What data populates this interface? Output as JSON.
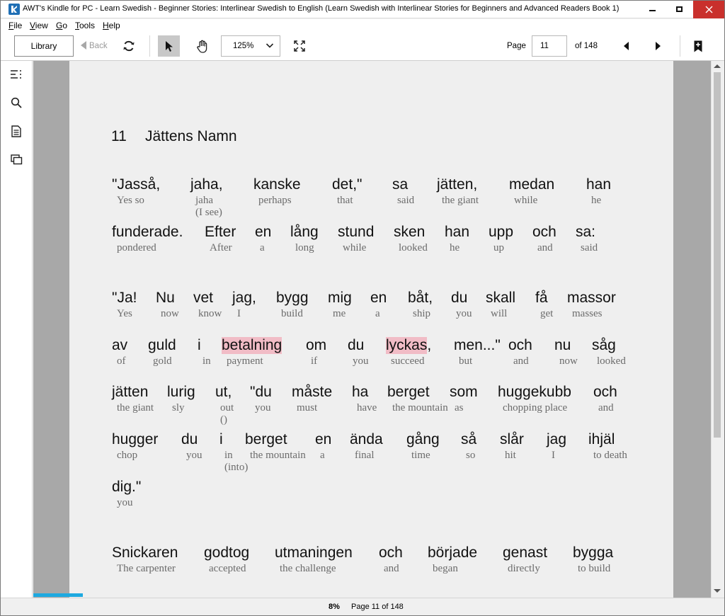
{
  "window": {
    "title": "AWT's Kindle for PC - Learn Swedish - Beginner Stories: Interlinear Swedish to English (Learn Swedish with Interlinear Stories for Beginners and Advanced Readers Book 1)",
    "close_color": "#c9302c"
  },
  "menu": [
    "File",
    "View",
    "Go",
    "Tools",
    "Help"
  ],
  "toolbar": {
    "library_label": "Library",
    "back_label": "Back",
    "zoom": "125%",
    "page_label": "Page",
    "page_value": "11",
    "page_of": "of 148"
  },
  "icons": {
    "sidebar": [
      "table-of-contents-icon",
      "search-icon",
      "notes-icon",
      "flashcards-icon"
    ],
    "toolbar": [
      "sync-icon",
      "select-cursor-icon",
      "hand-pan-icon",
      "fullscreen-icon",
      "prev-page-icon",
      "next-page-icon",
      "bookmark-add-icon"
    ]
  },
  "book": {
    "chapter_number": "11",
    "chapter_title": "Jättens Namn",
    "highlight_color": "#f1bcc6",
    "lines": [
      [
        [
          "\"Jasså,",
          "Yes so"
        ],
        [
          "jaha,",
          "jaha\n(I see)"
        ],
        [
          "kanske",
          "perhaps"
        ],
        [
          "det,\"",
          "that"
        ],
        [
          "sa",
          "said"
        ],
        [
          "jätten,",
          "the giant"
        ],
        [
          "medan",
          "while"
        ],
        [
          "han",
          "he"
        ]
      ],
      [
        [
          "funderade.",
          "pondered"
        ],
        [
          "Efter",
          "After"
        ],
        [
          "en",
          "a"
        ],
        [
          "lång",
          "long"
        ],
        [
          "stund",
          "while"
        ],
        [
          "sken",
          "looked"
        ],
        [
          "han",
          "he"
        ],
        [
          "upp",
          "up"
        ],
        [
          "och",
          "and"
        ],
        [
          "sa:",
          "said"
        ]
      ],
      [
        [
          "\"Ja!",
          "Yes"
        ],
        [
          "Nu",
          "now"
        ],
        [
          "vet",
          "know"
        ],
        [
          "jag,",
          "I"
        ],
        [
          "bygg",
          "build"
        ],
        [
          "mig",
          "me"
        ],
        [
          "en",
          "a"
        ],
        [
          "båt,",
          "ship"
        ],
        [
          "du",
          "you"
        ],
        [
          "skall",
          "will"
        ],
        [
          "få",
          "get"
        ],
        [
          "massor",
          "masses"
        ]
      ],
      [
        [
          "av",
          "of"
        ],
        [
          "guld",
          "gold"
        ],
        [
          "i",
          "in"
        ],
        [
          "betalning",
          "payment"
        ],
        [
          "om",
          "if"
        ],
        [
          "du",
          "you"
        ],
        [
          "lyckas,",
          "succeed"
        ],
        [
          "men...\"",
          "but"
        ],
        [
          "och",
          "and"
        ],
        [
          "nu",
          "now"
        ],
        [
          "såg",
          "looked"
        ]
      ],
      [
        [
          "jätten",
          "the giant"
        ],
        [
          "lurig",
          "sly"
        ],
        [
          "ut,",
          "out\n()"
        ],
        [
          "\"du",
          "you"
        ],
        [
          "måste",
          "must"
        ],
        [
          "ha",
          "have"
        ],
        [
          "berget",
          "the mountain"
        ],
        [
          "som",
          "as"
        ],
        [
          "huggekubb",
          "chopping place"
        ],
        [
          "och",
          "and"
        ]
      ],
      [
        [
          "hugger",
          "chop"
        ],
        [
          "du",
          "you"
        ],
        [
          "i",
          "in\n(into)"
        ],
        [
          "berget",
          "the mountain"
        ],
        [
          "en",
          "a"
        ],
        [
          "ända",
          "final"
        ],
        [
          "gång",
          "time"
        ],
        [
          "så",
          "so"
        ],
        [
          "slår",
          "hit"
        ],
        [
          "jag",
          "I"
        ],
        [
          "ihjäl",
          "to death"
        ]
      ],
      [
        [
          "dig.\"",
          "you"
        ]
      ],
      [
        [
          "Snickaren",
          "The carpenter"
        ],
        [
          "godtog",
          "accepted"
        ],
        [
          "utmaningen",
          "the challenge"
        ],
        [
          "och",
          "and"
        ],
        [
          "började",
          "began"
        ],
        [
          "genast",
          "directly"
        ],
        [
          "bygga",
          "to build"
        ]
      ]
    ]
  },
  "status": {
    "progress_percent": "8%",
    "progress_fraction": 0.08,
    "page_text": "Page 11 of 148",
    "progress_color": "#1ea9e0"
  }
}
